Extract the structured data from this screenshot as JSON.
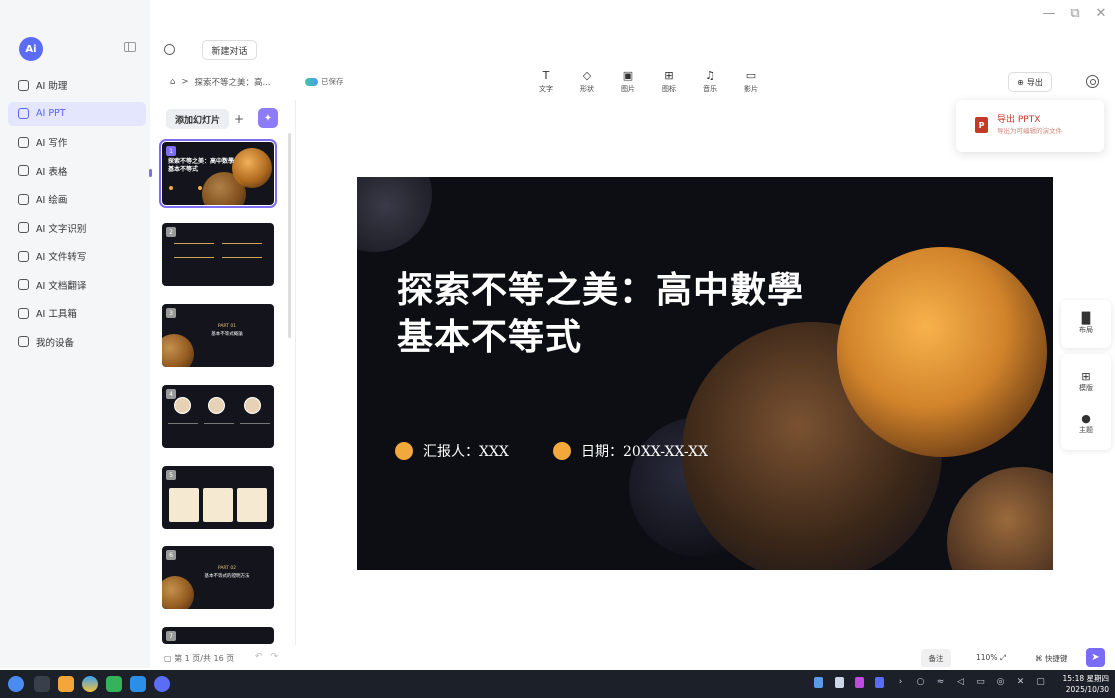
{
  "window": {
    "controls": [
      "—",
      "⧉",
      "✕"
    ]
  },
  "sidebar": {
    "logo": "Ai",
    "items": [
      {
        "label": "AI 助理",
        "icon": "robot-icon",
        "active": false
      },
      {
        "label": "AI PPT",
        "icon": "ppt-icon",
        "active": true
      },
      {
        "label": "AI 写作",
        "icon": "pen-icon",
        "active": false
      },
      {
        "label": "AI 表格",
        "icon": "table-icon",
        "active": false
      },
      {
        "label": "AI 绘画",
        "icon": "palette-icon",
        "active": false
      },
      {
        "label": "AI 文字识别",
        "icon": "scan-text-icon",
        "active": false
      },
      {
        "label": "AI 文件转写",
        "icon": "transcribe-icon",
        "active": false
      },
      {
        "label": "AI 文档翻译",
        "icon": "translate-icon",
        "active": false
      },
      {
        "label": "AI 工具箱",
        "icon": "toolbox-icon",
        "active": false
      },
      {
        "label": "我的设备",
        "icon": "device-icon",
        "active": false
      }
    ]
  },
  "topbar": {
    "new_chat": "新建对话",
    "breadcrumb_home": "⌂",
    "breadcrumb_sep": ">",
    "breadcrumb_title": "探索不等之美：高...",
    "saved": "已保存",
    "tools": [
      {
        "label": "文字",
        "glyph": "T",
        "icon": "text-icon"
      },
      {
        "label": "形状",
        "glyph": "◇",
        "icon": "shape-icon"
      },
      {
        "label": "图片",
        "glyph": "▣",
        "icon": "image-icon"
      },
      {
        "label": "图标",
        "glyph": "⊞",
        "icon": "icon-library-icon"
      },
      {
        "label": "音乐",
        "glyph": "♫",
        "icon": "music-icon"
      },
      {
        "label": "影片",
        "glyph": "▭",
        "icon": "video-icon"
      }
    ],
    "export": "导出",
    "export_menu": {
      "title": "导出 PPTX",
      "desc": "导出为可编辑的演文件",
      "badge": "P"
    }
  },
  "slides_panel": {
    "add_slide": "添加幻灯片",
    "add_plus": "+",
    "magic": "✦",
    "thumbs": [
      {
        "num": "1",
        "title": "探索不等之美：高中数學基本不等式"
      },
      {
        "num": "2"
      },
      {
        "num": "3",
        "part": "PART 01",
        "caption": "基本不等式概論"
      },
      {
        "num": "4"
      },
      {
        "num": "5"
      },
      {
        "num": "6",
        "part": "PART 02",
        "caption": "基本不等式的證明方法"
      },
      {
        "num": "7"
      }
    ]
  },
  "slide": {
    "title_line1": "探索不等之美：高中數學",
    "title_line2": "基本不等式",
    "reporter": "汇报人：XXX",
    "date": "日期：20XX-XX-XX"
  },
  "right_panel": {
    "layout": "布局",
    "template": "模版",
    "theme": "主题"
  },
  "status": {
    "page": "第 1 页/共 16 页",
    "undo": "↶",
    "redo": "↷",
    "notes": "备注",
    "zoom": "110%",
    "shortcut": "快捷键"
  },
  "taskbar": {
    "time": "15:18 星期四",
    "date": "2025/10/30"
  }
}
